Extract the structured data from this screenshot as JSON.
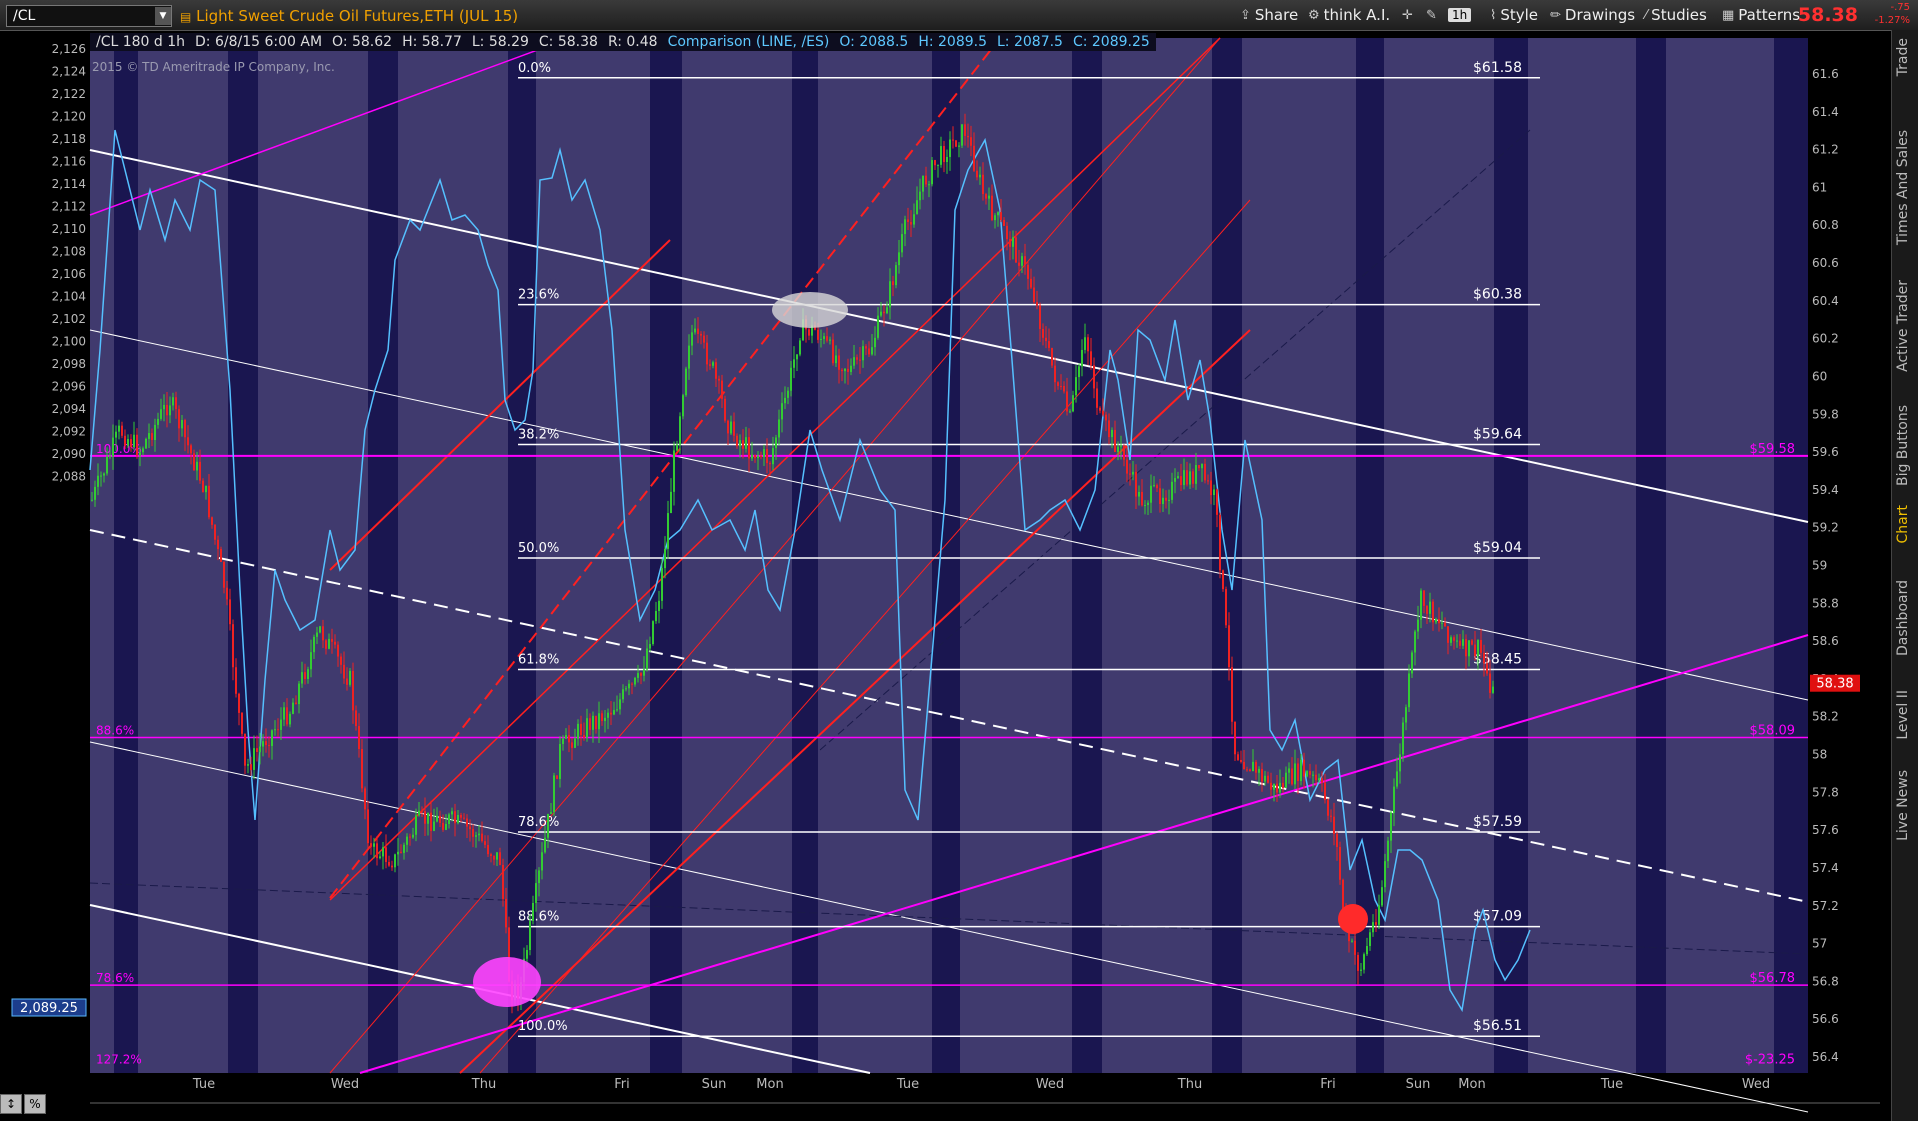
{
  "header": {
    "symbol": "/CL",
    "title": "Light Sweet Crude Oil Futures,ETH (JUL 15)",
    "share": "Share",
    "think_ai": "think A.I.",
    "timeframe": "1h",
    "style": "Style",
    "drawings": "Drawings",
    "studies": "Studies",
    "patterns": "Patterns",
    "last_price": "58.38",
    "change": "-.75",
    "change_pct": "-1.27%"
  },
  "infobar": {
    "sym": "/CL 180 d 1h",
    "date": "D: 6/8/15 6:00 AM",
    "open": "O: 58.62",
    "high": "H: 58.77",
    "low": "L: 58.29",
    "close": "C: 58.38",
    "range": "R: 0.48",
    "cmp_label": "Comparison (LINE, /ES)",
    "cmp_open": "O: 2088.5",
    "cmp_high": "H: 2089.5",
    "cmp_low": "L: 2087.5",
    "cmp_close": "C: 2089.25"
  },
  "copyright": "2015 © TD Ameritrade IP Company, Inc.",
  "side_tabs": [
    "Trade",
    "Times And Sales",
    "Active Trader",
    "Big Buttons",
    "Chart",
    "Dashboard",
    "Level II",
    "Live News"
  ],
  "bottom_buttons": [
    "↕",
    "%"
  ],
  "colors": {
    "background": "#403a6e",
    "session_band": "#1a1650",
    "fib_line": "#ffffff",
    "magenta": "#ff00ff",
    "red": "#ff2020",
    "comparison": "#55c0ff",
    "up_candle": "#33cc33",
    "down_candle": "#ee2222"
  },
  "chart_data": {
    "type": "candlestick",
    "left_axis": {
      "label_range": [
        2088,
        2126
      ],
      "ticks": [
        "2,126",
        "2,124",
        "2,122",
        "2,120",
        "2,118",
        "2,116",
        "2,114",
        "2,112",
        "2,110",
        "2,108",
        "2,106",
        "2,104",
        "2,102",
        "2,100",
        "2,098",
        "2,096",
        "2,094",
        "2,092",
        "2,090",
        "2,088"
      ],
      "current": "2,089.25"
    },
    "right_axis": {
      "label_range": [
        56.4,
        61.6
      ],
      "ticks": [
        "61.6",
        "61.4",
        "61.2",
        "61",
        "60.8",
        "60.6",
        "60.4",
        "60.2",
        "60",
        "59.8",
        "59.6",
        "59.4",
        "59.2",
        "59",
        "58.8",
        "58.6",
        "58.4",
        "58.2",
        "58",
        "57.8",
        "57.6",
        "57.4",
        "57.2",
        "57",
        "56.8",
        "56.6",
        "56.4"
      ],
      "current": "58.38"
    },
    "x_labels": [
      "Tue",
      "Wed",
      "Thu",
      "Fri",
      "Sun",
      "Mon",
      "Tue",
      "Wed",
      "Thu",
      "Fri",
      "Sun",
      "Mon",
      "Tue",
      "Wed"
    ],
    "fib_levels": [
      {
        "pct": "0.0%",
        "price": "$61.58",
        "value": 61.58
      },
      {
        "pct": "23.6%",
        "price": "$60.38",
        "value": 60.38
      },
      {
        "pct": "38.2%",
        "price": "$59.64",
        "value": 59.64
      },
      {
        "pct": "50.0%",
        "price": "$59.04",
        "value": 59.04
      },
      {
        "pct": "61.8%",
        "price": "$58.45",
        "value": 58.45
      },
      {
        "pct": "78.6%",
        "price": "$57.59",
        "value": 57.59
      },
      {
        "pct": "88.6%",
        "price": "$57.09",
        "value": 57.09
      },
      {
        "pct": "100.0%",
        "price": "$56.51",
        "value": 56.51
      }
    ],
    "magenta_levels": [
      {
        "pct": "100.0%",
        "price": "$59.58",
        "value": 59.58
      },
      {
        "pct": "88.6%",
        "price": "$58.09",
        "value": 58.09
      },
      {
        "pct": "78.6%",
        "price": "$56.78",
        "value": 56.78
      },
      {
        "pct": "127.2%",
        "price": "$-23.25",
        "value": 56.35
      }
    ]
  }
}
